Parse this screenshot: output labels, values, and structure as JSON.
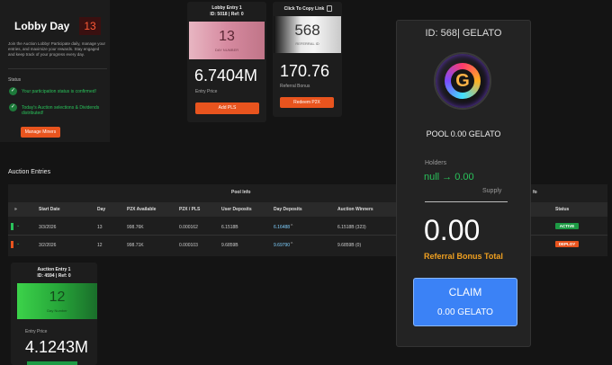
{
  "lobby": {
    "title": "Lobby Day",
    "day": "13",
    "description": "Join the Auction Lobby! Participate daily, manage your entries, and maximize your rewards. Stay engaged and keep track of your progress every day.",
    "status_label": "Status",
    "status_items": [
      "Your participation status is confirmed!",
      "Today's Auction selections & Dividends distributed!"
    ],
    "manage_button": "Manage Miners"
  },
  "entry_top": {
    "title": "Lobby Entry 1",
    "ids": "ID: 5018 | Ref: 0",
    "day_number": "13",
    "day_label": "DAY NUMBER",
    "price": "6.7404M",
    "price_label": "Entry Price",
    "button": "Add PLS"
  },
  "referral_card": {
    "header": "Click To Copy Link",
    "number": "568",
    "label": "REFERRAL ID",
    "bonus": "170.76",
    "bonus_label": "Referral Bonus",
    "button": "Redeem P2X"
  },
  "claim_panel": {
    "title": "ID: 568| GELATO",
    "pool": "POOL 0.00 GELATO",
    "holders_label": "Holders",
    "holders_value": "null → 0.00",
    "supply_label": "Supply",
    "big_value": "0.00",
    "ref_bonus_label": "Referral Bonus Total",
    "claim_label": "CLAIM",
    "claim_amount": "0.00  GELATO"
  },
  "auction_entries": {
    "heading": "Auction Entries",
    "group_pool": "Pool Info",
    "group_right": "fo",
    "columns": [
      "»",
      "Start Date",
      "Day",
      "P2X Available",
      "P2X / PLS",
      "User Deposits",
      "Day Deposits",
      "Auction Winners",
      "Status"
    ],
    "rows": [
      {
        "date": "3/3/2026",
        "day": "13",
        "avail": "998.76K",
        "ratio": "0.000162",
        "user": "6.1518B",
        "deposits": "6.16488",
        "winners": "6.1518B (323)",
        "status": "ACTIVE"
      },
      {
        "date": "3/2/2026",
        "day": "12",
        "avail": "998.71K",
        "ratio": "0.000103",
        "user": "9.6859B",
        "deposits": "9.69790",
        "winners": "9.6859B (0)",
        "status": "DEPLOY"
      }
    ]
  },
  "entry_bottom": {
    "title": "Auction Entry 1",
    "ids": "ID: 4594 | Ref: 0",
    "day_number": "12",
    "day_label": "Day Number",
    "price_label": "Entry Price",
    "price": "4.1243M"
  },
  "colors": {
    "accent_orange": "#e8541e",
    "success_green": "#29c25a",
    "claim_blue": "#3b82f6",
    "bonus_gold": "#f0a020"
  }
}
